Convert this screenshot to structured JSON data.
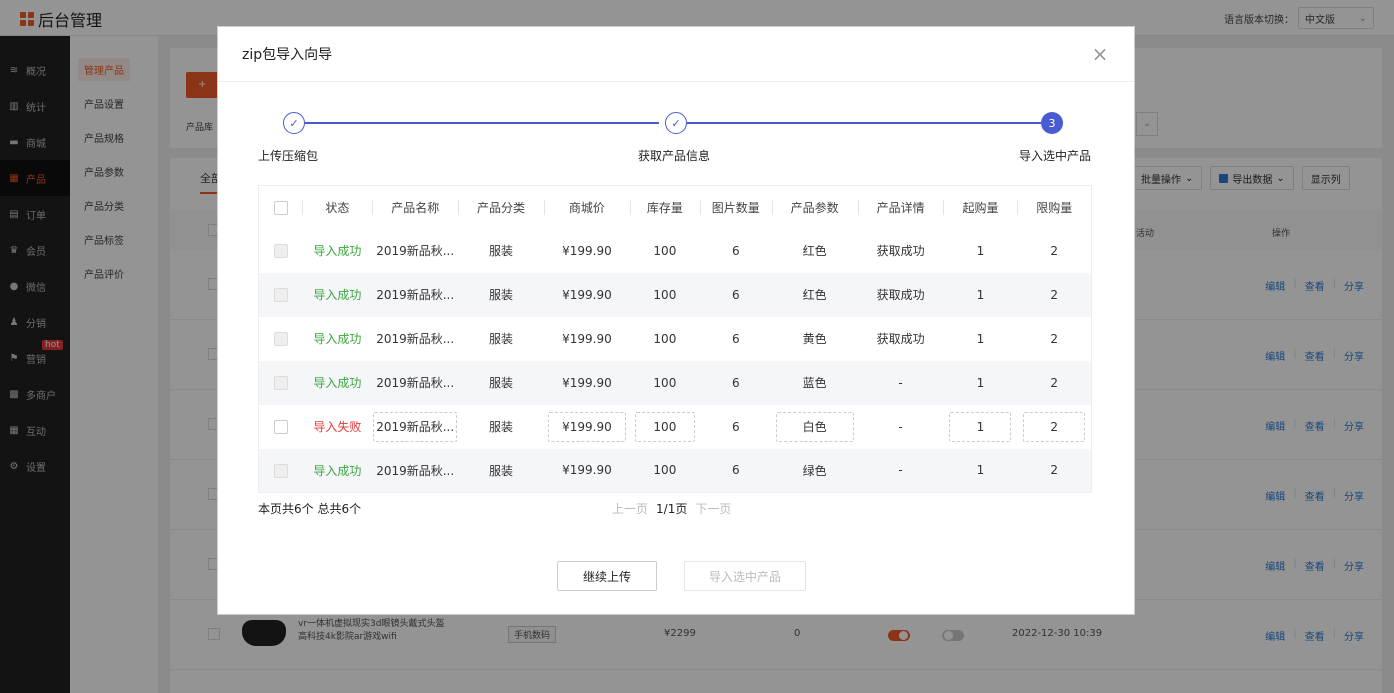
{
  "app": {
    "title": "后台管理",
    "lang_label": "语言版本切换：",
    "lang_value": "中文版"
  },
  "sidebar": {
    "items": [
      {
        "label": "概况",
        "icon": "layers-icon"
      },
      {
        "label": "统计",
        "icon": "chart-icon"
      },
      {
        "label": "商城",
        "icon": "store-icon"
      },
      {
        "label": "产品",
        "icon": "product-icon",
        "active": true
      },
      {
        "label": "订单",
        "icon": "order-icon"
      },
      {
        "label": "会员",
        "icon": "crown-icon"
      },
      {
        "label": "微信",
        "icon": "wechat-icon"
      },
      {
        "label": "分销",
        "icon": "users-icon"
      },
      {
        "label": "营销",
        "icon": "flag-icon",
        "badge": "hot"
      },
      {
        "label": "多商户",
        "icon": "merchant-icon"
      },
      {
        "label": "互动",
        "icon": "grid-icon"
      },
      {
        "label": "设置",
        "icon": "gear-icon"
      }
    ]
  },
  "subnav": {
    "items": [
      "管理产品",
      "产品设置",
      "产品规格",
      "产品参数",
      "产品分类",
      "产品标签",
      "产品评价"
    ]
  },
  "background": {
    "add_label": "+",
    "filter_label": "产品库",
    "tab_label": "全部",
    "batch_label": "批量操作",
    "export_label": "导出数据",
    "columns_label": "显示列",
    "col_activity": "活动",
    "col_ops": "操作",
    "op_edit": "编辑",
    "op_view": "查看",
    "op_share": "分享",
    "vr_name": "vr一体机虚拟现实3d眼镜头戴式头盔高科技4k影院ar游戏wifi",
    "vr_tag": "手机数码",
    "vr_price": "¥2299",
    "vr_stock": "0",
    "vr_date": "2022-12-30 10:39"
  },
  "modal": {
    "title": "zip包导入向导",
    "close_label": "×",
    "steps": [
      {
        "label": "上传压缩包",
        "state": "done",
        "mark": "✓"
      },
      {
        "label": "获取产品信息",
        "state": "done",
        "mark": "✓"
      },
      {
        "label": "导入选中产品",
        "state": "current",
        "mark": "3"
      }
    ],
    "columns": [
      "状态",
      "产品名称",
      "产品分类",
      "商城价",
      "库存量",
      "图片数量",
      "产品参数",
      "产品详情",
      "起购量",
      "限购量"
    ],
    "rows": [
      {
        "status": "导入成功",
        "ok": true,
        "name": "2019新品秋...",
        "category": "服装",
        "price": "¥199.90",
        "stock": "100",
        "images": "6",
        "param": "红色",
        "detail": "获取成功",
        "min": "1",
        "max": "2"
      },
      {
        "status": "导入成功",
        "ok": true,
        "name": "2019新品秋...",
        "category": "服装",
        "price": "¥199.90",
        "stock": "100",
        "images": "6",
        "param": "红色",
        "detail": "获取成功",
        "min": "1",
        "max": "2"
      },
      {
        "status": "导入成功",
        "ok": true,
        "name": "2019新品秋...",
        "category": "服装",
        "price": "¥199.90",
        "stock": "100",
        "images": "6",
        "param": "黄色",
        "detail": "获取成功",
        "min": "1",
        "max": "2"
      },
      {
        "status": "导入成功",
        "ok": true,
        "name": "2019新品秋...",
        "category": "服装",
        "price": "¥199.90",
        "stock": "100",
        "images": "6",
        "param": "蓝色",
        "detail": "-",
        "min": "1",
        "max": "2"
      },
      {
        "status": "导入失败",
        "ok": false,
        "name": "2019新品秋...",
        "category": "服装",
        "price": "¥199.90",
        "stock": "100",
        "images": "6",
        "param": "白色",
        "detail": "-",
        "min": "1",
        "max": "2"
      },
      {
        "status": "导入成功",
        "ok": true,
        "name": "2019新品秋...",
        "category": "服装",
        "price": "¥199.90",
        "stock": "100",
        "images": "6",
        "param": "绿色",
        "detail": "-",
        "min": "1",
        "max": "2"
      }
    ],
    "summary": "本页共6个 总共6个",
    "pager": {
      "prev": "上一页",
      "page": "1/1页",
      "next": "下一页"
    },
    "btn_continue": "继续上传",
    "btn_import": "导入选中产品"
  },
  "colors": {
    "accent": "#f05a28",
    "step_blue": "#4a5bd1",
    "success": "#3aa63a",
    "fail": "#e4393c"
  }
}
